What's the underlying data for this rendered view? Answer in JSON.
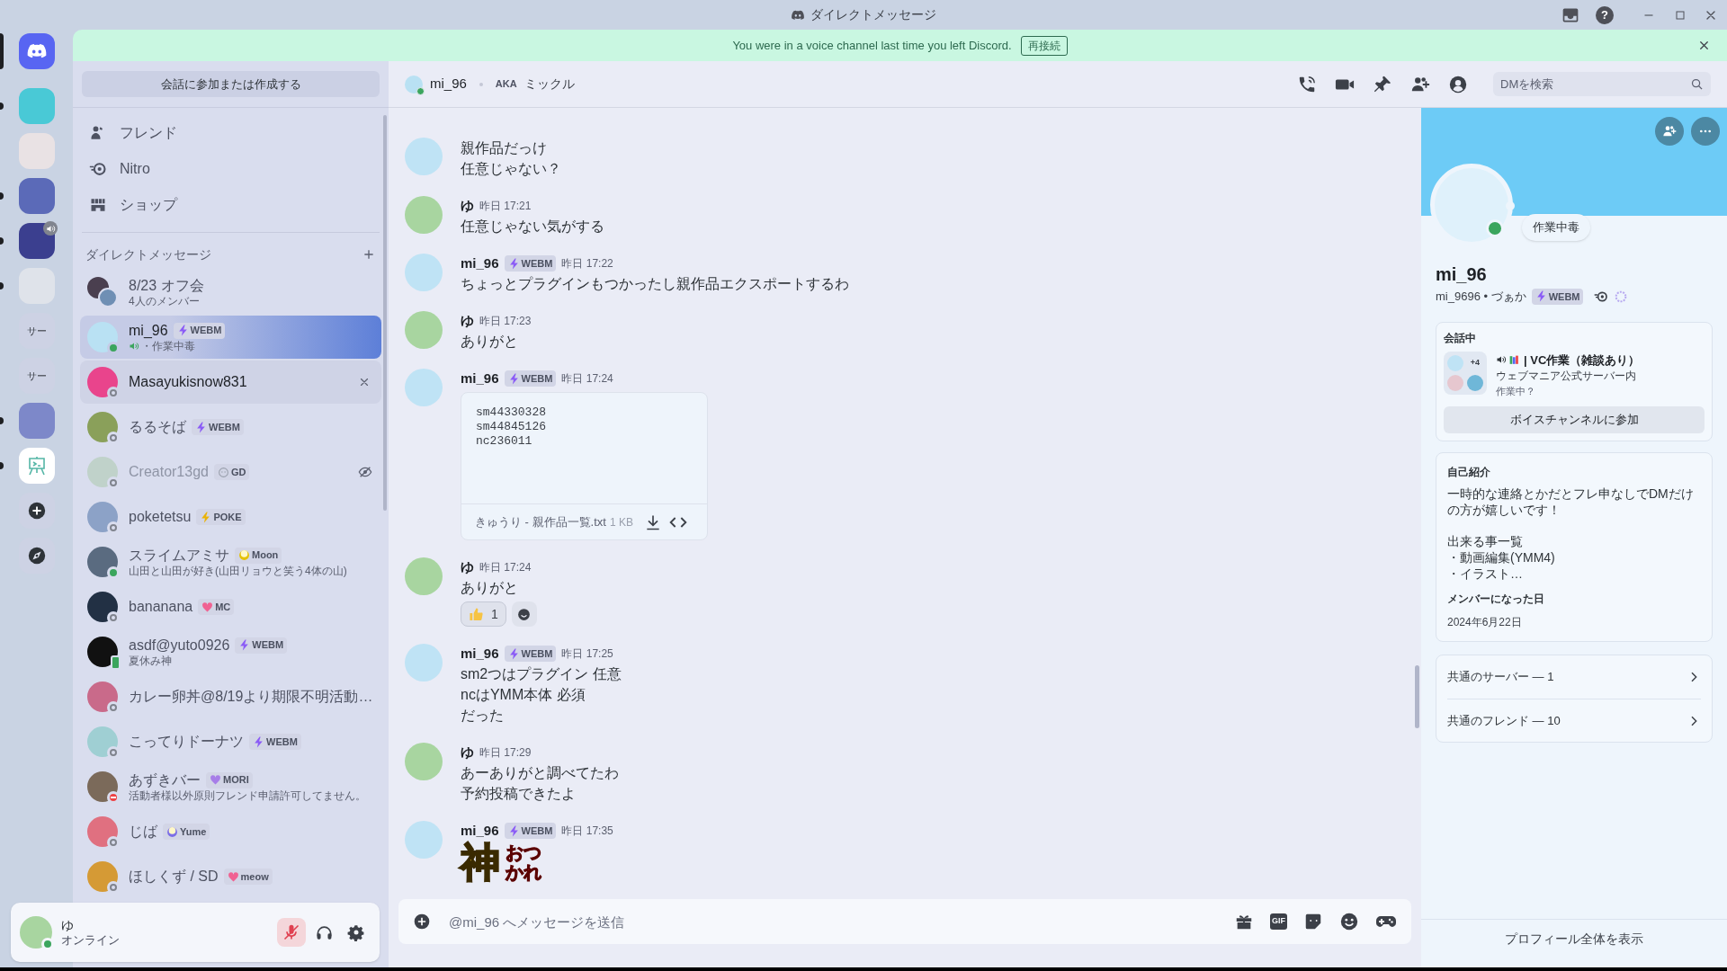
{
  "title_bar": {
    "title": "ダイレクトメッセージ",
    "help_label": "?"
  },
  "servers": [
    {
      "kind": "home",
      "selected": true,
      "unread": false,
      "in_voice": false
    },
    {
      "kind": "image",
      "selected": false,
      "unread": true,
      "in_voice": false
    },
    {
      "kind": "image",
      "selected": false,
      "unread": false,
      "in_voice": false
    },
    {
      "kind": "image",
      "selected": false,
      "unread": true,
      "in_voice": false
    },
    {
      "kind": "image",
      "selected": false,
      "unread": true,
      "in_voice": true
    },
    {
      "kind": "image",
      "selected": false,
      "unread": true,
      "in_voice": false
    },
    {
      "kind": "text",
      "label": "サー",
      "selected": false,
      "unread": false,
      "in_voice": false
    },
    {
      "kind": "text",
      "label": "サー",
      "selected": false,
      "unread": false,
      "in_voice": false
    },
    {
      "kind": "image",
      "selected": false,
      "unread": true,
      "in_voice": false
    },
    {
      "kind": "easel",
      "selected": false,
      "unread": true,
      "in_voice": false
    },
    {
      "kind": "add",
      "selected": false,
      "unread": false,
      "in_voice": false
    },
    {
      "kind": "discover",
      "selected": false,
      "unread": false,
      "in_voice": false
    }
  ],
  "notice": {
    "text": "You were in a voice channel last time you left Discord.",
    "button": "再接続"
  },
  "sidebar": {
    "create_button": "会話に参加または作成する",
    "nav": [
      {
        "label": "フレンド"
      },
      {
        "label": "Nitro"
      },
      {
        "label": "ショップ"
      }
    ],
    "dm_header": "ダイレクトメッセージ",
    "dms": [
      {
        "kind": "group",
        "name": "8/23 オフ会",
        "subtitle": "4人のメンバー",
        "selected": false,
        "hovered": false,
        "hidden": false,
        "in_voice": false
      },
      {
        "kind": "user",
        "name": "mi_96",
        "tag": {
          "kind": "bolt",
          "label": "WEBM",
          "color": "#8b5cf6"
        },
        "subtitle": "・作業中毒",
        "status": {
          "kind": "dot",
          "color": "#3ba55d"
        },
        "selected": true,
        "hovered": false,
        "hidden": false,
        "in_voice": true
      },
      {
        "kind": "user",
        "name": "Masayukisnow831",
        "status": {
          "kind": "ring",
          "color": "#80848e"
        },
        "selected": false,
        "hovered": true,
        "hidden": false,
        "in_voice": false
      },
      {
        "kind": "user",
        "name": "るるそば",
        "tag": {
          "kind": "bolt",
          "label": "WEBM",
          "color": "#8b5cf6"
        },
        "status": {
          "kind": "ring",
          "color": "#80848e"
        },
        "selected": false,
        "hovered": false,
        "hidden": false,
        "in_voice": false
      },
      {
        "kind": "user",
        "name": "Creator13gd",
        "tag": {
          "kind": "face",
          "label": "GD",
          "color": "#9aa0ad"
        },
        "status": {
          "kind": "ring",
          "color": "#80848e"
        },
        "selected": false,
        "hovered": false,
        "hidden": true,
        "in_voice": false
      },
      {
        "kind": "user",
        "name": "poketetsu",
        "tag": {
          "kind": "bolt",
          "label": "POKE",
          "color": "#eab308"
        },
        "status": {
          "kind": "ring",
          "color": "#80848e"
        },
        "selected": false,
        "hovered": false,
        "hidden": false,
        "in_voice": false
      },
      {
        "kind": "user",
        "name": "スライムアミサ",
        "tag": {
          "kind": "moon",
          "label": "Moon",
          "color": "#e5c100"
        },
        "subtitle": "山田と山田が好き(山田リョウと笑う4体の山)",
        "status": {
          "kind": "dot",
          "color": "#3ba55d"
        },
        "selected": false,
        "hovered": false,
        "hidden": false,
        "in_voice": false
      },
      {
        "kind": "user",
        "name": "bananana",
        "tag": {
          "kind": "heart",
          "label": "MC",
          "color": "#f06292"
        },
        "status": {
          "kind": "ring",
          "color": "#80848e"
        },
        "selected": false,
        "hovered": false,
        "hidden": false,
        "in_voice": false
      },
      {
        "kind": "user",
        "name": "asdf@yuto0926",
        "tag": {
          "kind": "bolt",
          "label": "WEBM",
          "color": "#8b5cf6"
        },
        "subtitle": "夏休み神",
        "status": {
          "kind": "phone",
          "color": "#3ba55d"
        },
        "selected": false,
        "hovered": false,
        "hidden": false,
        "in_voice": false
      },
      {
        "kind": "user",
        "name": "カレー卵丼@8/19より期限不明活動…",
        "status": {
          "kind": "ring",
          "color": "#80848e"
        },
        "selected": false,
        "hovered": false,
        "hidden": false,
        "in_voice": false
      },
      {
        "kind": "user",
        "name": "こってりドーナツ",
        "tag": {
          "kind": "bolt",
          "label": "WEBM",
          "color": "#8b5cf6"
        },
        "status": {
          "kind": "ring",
          "color": "#80848e"
        },
        "selected": false,
        "hovered": false,
        "hidden": false,
        "in_voice": false
      },
      {
        "kind": "user",
        "name": "あずきバー",
        "tag": {
          "kind": "heart",
          "label": "MORI",
          "color": "#a77ee8"
        },
        "subtitle": "活動者様以外原則フレンド申請許可してません。",
        "status": {
          "kind": "minus",
          "color": "#ed4245"
        },
        "selected": false,
        "hovered": false,
        "hidden": false,
        "in_voice": false
      },
      {
        "kind": "user",
        "name": "じば",
        "tag": {
          "kind": "moon",
          "label": "Yume",
          "color": "#7c6ee6"
        },
        "status": {
          "kind": "ring",
          "color": "#80848e"
        },
        "selected": false,
        "hovered": false,
        "hidden": false,
        "in_voice": false
      },
      {
        "kind": "user",
        "name": "ほしくず / SD",
        "tag": {
          "kind": "heart",
          "label": "meow",
          "color": "#f06292"
        },
        "status": {
          "kind": "ring",
          "color": "#80848e"
        },
        "selected": false,
        "hovered": false,
        "hidden": false,
        "in_voice": false
      }
    ]
  },
  "user_panel": {
    "name": "ゆ",
    "status_text": "オンライン",
    "status": {
      "kind": "dot",
      "color": "#3ba55d"
    },
    "mic_muted": true
  },
  "header": {
    "name": "mi_96",
    "aka_label": "AKA",
    "aka": "ミックル",
    "search_placeholder": "DMを検索"
  },
  "messages": [
    {
      "kind": "other",
      "lines": [
        "親作品だっけ",
        "任意じゃない？"
      ]
    },
    {
      "kind": "self",
      "author": "ゆ",
      "time": "昨日 17:21",
      "lines": [
        "任意じゃない気がする"
      ]
    },
    {
      "kind": "other",
      "author": "mi_96",
      "tag": {
        "kind": "bolt",
        "label": "WEBM",
        "color": "#8b5cf6"
      },
      "time": "昨日 17:22",
      "lines": [
        "ちょっとプラグインもつかったし親作品エクスポートするわ"
      ]
    },
    {
      "kind": "self",
      "author": "ゆ",
      "time": "昨日 17:23",
      "lines": [
        "ありがと"
      ]
    },
    {
      "kind": "other",
      "author": "mi_96",
      "tag": {
        "kind": "bolt",
        "label": "WEBM",
        "color": "#8b5cf6"
      },
      "time": "昨日 17:24",
      "attachment": {
        "code_lines": [
          "sm44330328",
          "sm44845126",
          "nc236011"
        ],
        "filename": "きゅうり - 親作品一覧.txt",
        "size": "1 KB"
      }
    },
    {
      "kind": "self",
      "author": "ゆ",
      "time": "昨日 17:24",
      "lines": [
        "ありがと"
      ],
      "reactions": [
        {
          "count": "1"
        }
      ]
    },
    {
      "kind": "other",
      "author": "mi_96",
      "tag": {
        "kind": "bolt",
        "label": "WEBM",
        "color": "#8b5cf6"
      },
      "time": "昨日 17:25",
      "lines": [
        "sm2つはプラグイン 任意",
        "ncはYMM本体 必須",
        "だった"
      ]
    },
    {
      "kind": "self",
      "author": "ゆ",
      "time": "昨日 17:29",
      "lines": [
        "あーありがと調べてたわ",
        "予約投稿できたよ"
      ]
    },
    {
      "kind": "other",
      "author": "mi_96",
      "tag": {
        "kind": "bolt",
        "label": "WEBM",
        "color": "#8b5cf6"
      },
      "time": "昨日 17:35",
      "stickers": [
        {
          "kind": "gold",
          "lines": [
            "神"
          ]
        },
        {
          "kind": "red",
          "lines": [
            "おつ",
            "かれ"
          ]
        }
      ]
    }
  ],
  "composer": {
    "placeholder": "@mi_96 へメッセージを送信",
    "gif_label": "GIF"
  },
  "profile": {
    "status_bubble": "作業中毒",
    "display_name": "mi_96",
    "username_line": "mi_9696 • づぁか",
    "tag": {
      "kind": "bolt",
      "label": "WEBM",
      "color": "#8b5cf6"
    },
    "status": {
      "kind": "dot",
      "color": "#3ba55d"
    },
    "voice": {
      "heading": "会話中",
      "extra_count": "+4",
      "channel": "| VC作業（雑談あり）",
      "server": "ウェブマニア公式サーバー内",
      "topic": "作業中？",
      "join_button": "ボイスチャンネルに参加"
    },
    "about": {
      "heading": "自己紹介",
      "sections": [
        {
          "lines": [
            "一時的な連絡とかだとフレ申なしでDMだけの方が嬉しいです！"
          ]
        },
        {
          "lines": [
            "出来る事一覧",
            "・動画編集(YMM4)",
            "・イラスト…"
          ]
        }
      ],
      "member_since_heading": "メンバーになった日",
      "member_since": "2024年6月22日"
    },
    "mutual": [
      {
        "label": "共通のサーバー — 1"
      },
      {
        "label": "共通のフレンド — 10"
      }
    ],
    "footer": "プロフィール全体を表示"
  }
}
